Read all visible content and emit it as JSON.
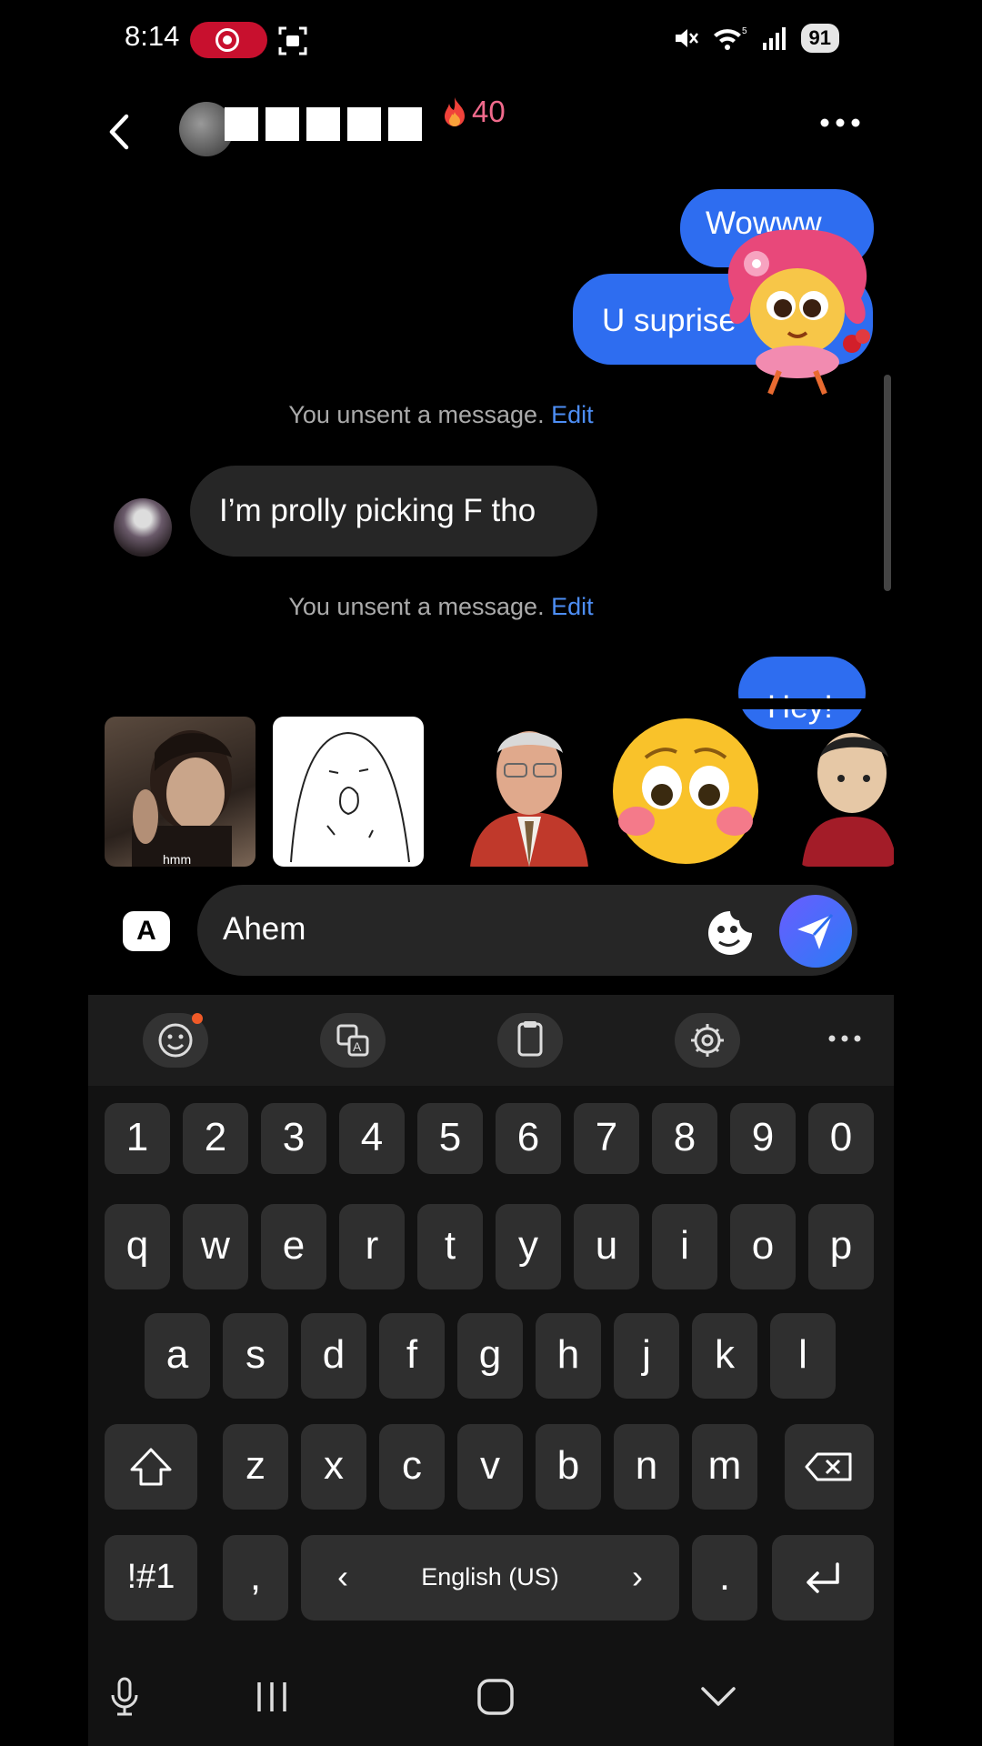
{
  "status_bar": {
    "time": "8:14",
    "battery": "91",
    "signal_badge": "5"
  },
  "header": {
    "streak_icon": "fire-icon",
    "streak_count": "40",
    "more_icon": "more-horizontal-icon",
    "back_icon": "chevron-left-icon"
  },
  "messages": {
    "out1": "Wowww",
    "out2": "U suprise",
    "unsent_text": "You unsent a message.",
    "unsent_edit": "Edit",
    "in1": "I’m prolly picking F tho",
    "out3_partial": "Hey!"
  },
  "stickers": {
    "hmm_caption": "hmm"
  },
  "composer": {
    "toggle_label": "A",
    "text": "Ahem"
  },
  "keyboard": {
    "row_numbers": [
      "1",
      "2",
      "3",
      "4",
      "5",
      "6",
      "7",
      "8",
      "9",
      "0"
    ],
    "row_q": [
      "q",
      "w",
      "e",
      "r",
      "t",
      "y",
      "u",
      "i",
      "o",
      "p"
    ],
    "row_a": [
      "a",
      "s",
      "d",
      "f",
      "g",
      "h",
      "j",
      "k",
      "l"
    ],
    "row_z": [
      "z",
      "x",
      "c",
      "v",
      "b",
      "n",
      "m"
    ],
    "sym_label": "!#1",
    "comma": ",",
    "period": ".",
    "language": "English (US)",
    "lang_prev": "‹",
    "lang_next": "›"
  }
}
